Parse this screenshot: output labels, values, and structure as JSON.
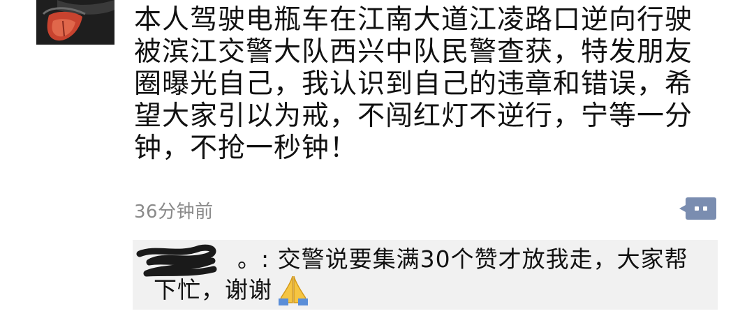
{
  "post": {
    "text": "本人驾驶电瓶车在江南大道江凌路口逆向行驶\n被滨江交警大队西兴中队民警查获，特发朋友\n圈曝光自己，我认识到自己的违章和错误，希\n望大家引以为戒，不闯红灯不逆行，宁等一分\n钟，不抢一秒钟！",
    "timestamp": "36分钟前"
  },
  "comment": {
    "line1": "。: 交警说要集满30个赞才放我走，大家帮",
    "line2": "下忙，谢谢",
    "emoji": "pray-hands"
  },
  "colors": {
    "comment_button": "#7a8db0",
    "comment_bg": "#f1f1f1",
    "timestamp": "#8a8a8a"
  }
}
